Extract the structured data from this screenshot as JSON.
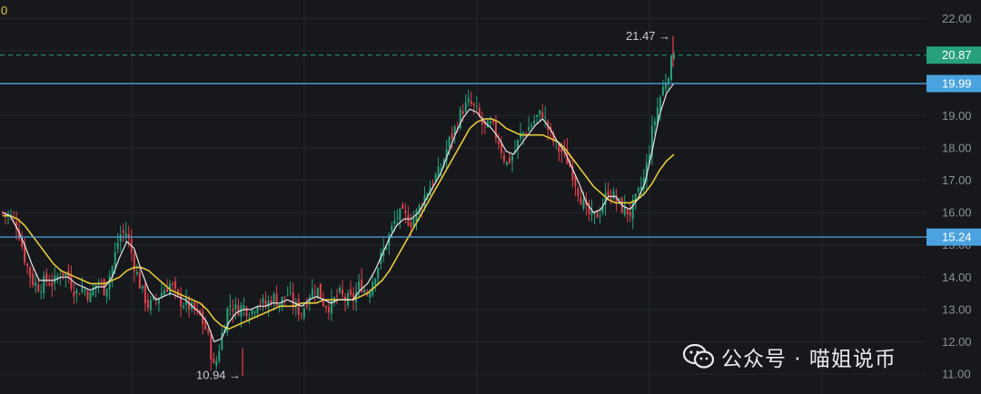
{
  "chart_data": {
    "type": "candlestick",
    "ylim": [
      10.8,
      22.2
    ],
    "y_ticks": [
      "11.00",
      "12.00",
      "13.00",
      "14.00",
      "15.00",
      "16.00",
      "17.00",
      "18.00",
      "19.00",
      "20.00",
      "21.00",
      "22.00"
    ],
    "y_tick_values": [
      11,
      12,
      13,
      14,
      15,
      16,
      17,
      18,
      19,
      20,
      21,
      22
    ],
    "top_legend_fragment": "0",
    "grid": true,
    "current_price": {
      "value": 20.87,
      "label": "20.87",
      "color": "#26a17b"
    },
    "horizontal_levels": [
      {
        "value": 19.99,
        "label": "19.99",
        "color": "#4aa3df"
      },
      {
        "value": 15.24,
        "label": "15.24",
        "color": "#4aa3df"
      }
    ],
    "annotations": [
      {
        "value": 21.47,
        "label": "21.47",
        "arrow": "→",
        "kind": "high"
      },
      {
        "value": 10.94,
        "label": "10.94",
        "arrow": "→",
        "kind": "low"
      }
    ],
    "colors": {
      "up": "#26a17b",
      "down": "#e0424b",
      "ma_fast": "#e6e6e6",
      "ma_slow": "#e4c93a",
      "grid": "#24272d"
    },
    "price_path": [
      16.0,
      15.9,
      15.6,
      14.6,
      13.9,
      13.7,
      13.9,
      13.8,
      14.2,
      14.0,
      13.5,
      13.7,
      13.4,
      13.9,
      13.6,
      14.3,
      15.3,
      15.4,
      14.4,
      13.6,
      13.1,
      13.3,
      13.6,
      13.8,
      13.3,
      13.2,
      13.0,
      12.8,
      12.3,
      11.1,
      12.2,
      13.2,
      13.0,
      13.1,
      12.9,
      13.3,
      13.1,
      13.4,
      13.2,
      13.5,
      13.1,
      12.9,
      13.5,
      13.7,
      13.2,
      13.1,
      13.5,
      13.3,
      13.3,
      13.8,
      13.5,
      14.1,
      14.7,
      15.3,
      15.9,
      15.9,
      15.7,
      16.1,
      16.6,
      17.0,
      17.3,
      18.1,
      18.6,
      19.2,
      19.4,
      19.1,
      18.6,
      18.7,
      18.2,
      17.5,
      17.8,
      18.4,
      18.6,
      18.9,
      19.1,
      18.4,
      18.0,
      17.8,
      17.3,
      16.6,
      16.0,
      15.8,
      16.1,
      16.7,
      16.4,
      16.1,
      16.0,
      16.5,
      17.1,
      18.5,
      19.5,
      20.2,
      20.87
    ],
    "ma_fast_path": [
      16.0,
      15.9,
      15.5,
      15.0,
      14.4,
      13.9,
      13.9,
      13.9,
      14.0,
      14.0,
      13.8,
      13.7,
      13.6,
      13.7,
      13.7,
      14.0,
      14.6,
      15.1,
      14.9,
      14.2,
      13.6,
      13.3,
      13.4,
      13.5,
      13.4,
      13.3,
      13.1,
      12.9,
      12.6,
      12.0,
      12.1,
      12.6,
      12.9,
      13.0,
      13.0,
      13.1,
      13.1,
      13.2,
      13.2,
      13.3,
      13.2,
      13.1,
      13.3,
      13.4,
      13.3,
      13.2,
      13.3,
      13.3,
      13.3,
      13.6,
      13.8,
      14.2,
      14.7,
      15.2,
      15.6,
      15.8,
      15.8,
      16.0,
      16.4,
      16.8,
      17.2,
      17.8,
      18.4,
      18.9,
      19.2,
      19.1,
      18.8,
      18.6,
      18.3,
      17.9,
      17.8,
      18.1,
      18.4,
      18.7,
      18.9,
      18.6,
      18.2,
      17.9,
      17.4,
      16.9,
      16.3,
      16.0,
      16.1,
      16.5,
      16.5,
      16.2,
      16.1,
      16.4,
      16.9,
      17.9,
      19.0,
      19.7,
      20.0
    ],
    "ma_slow_path": [
      15.9,
      15.9,
      15.8,
      15.6,
      15.3,
      15.0,
      14.7,
      14.4,
      14.2,
      14.1,
      14.0,
      13.9,
      13.8,
      13.8,
      13.8,
      13.9,
      14.0,
      14.2,
      14.3,
      14.3,
      14.2,
      14.0,
      13.8,
      13.6,
      13.5,
      13.4,
      13.3,
      13.2,
      13.0,
      12.7,
      12.5,
      12.4,
      12.5,
      12.6,
      12.7,
      12.8,
      12.9,
      13.0,
      13.1,
      13.1,
      13.1,
      13.2,
      13.2,
      13.2,
      13.3,
      13.3,
      13.3,
      13.3,
      13.3,
      13.4,
      13.5,
      13.7,
      13.9,
      14.2,
      14.6,
      15.0,
      15.4,
      15.8,
      16.2,
      16.6,
      17.0,
      17.4,
      17.8,
      18.2,
      18.6,
      18.8,
      18.9,
      18.9,
      18.8,
      18.6,
      18.5,
      18.4,
      18.4,
      18.4,
      18.4,
      18.3,
      18.2,
      18.0,
      17.7,
      17.4,
      17.1,
      16.8,
      16.6,
      16.4,
      16.3,
      16.3,
      16.3,
      16.4,
      16.6,
      16.9,
      17.3,
      17.6,
      17.8
    ]
  },
  "watermark": {
    "text": "公众号 · 喵姐说币",
    "icon": "wechat-icon"
  }
}
